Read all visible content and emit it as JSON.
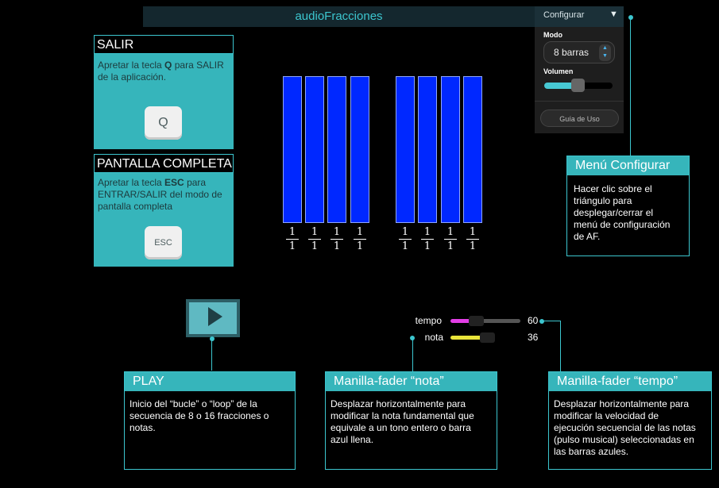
{
  "app": {
    "title": "audioFracciones"
  },
  "config": {
    "title": "Configurar",
    "toggle_glyph": "▼",
    "modo_label": "Modo",
    "modo_value": "8 barras",
    "stepper_glyph": "▲\n▼",
    "volumen_label": "Volumen",
    "volumen_level": 0.44,
    "guia_label": "Guía de Uso"
  },
  "salir": {
    "title": "SALIR",
    "text_a": "Apretar la tecla ",
    "key_bold": "Q",
    "text_b": "  para SALIR de la aplicación.",
    "key_label": "Q"
  },
  "fullscreen": {
    "title": "PANTALLA COMPLETA",
    "text_a": "Apretar la tecla ",
    "key_bold": "ESC",
    "text_b": "  para",
    "text_c": "ENTRAR/SALIR del modo de",
    "text_d": "pantalla completa",
    "key_label": "ESC"
  },
  "bars": {
    "fractions": [
      {
        "num": "1",
        "den": "1"
      },
      {
        "num": "1",
        "den": "1"
      },
      {
        "num": "1",
        "den": "1"
      },
      {
        "num": "1",
        "den": "1"
      },
      {
        "num": "1",
        "den": "1"
      },
      {
        "num": "1",
        "den": "1"
      },
      {
        "num": "1",
        "den": "1"
      },
      {
        "num": "1",
        "den": "1"
      }
    ]
  },
  "faders": {
    "tempo": {
      "label": "tempo",
      "value": "60",
      "color": "#e23ee6"
    },
    "nota": {
      "label": "nota",
      "value": "36",
      "color": "#e8e43a"
    }
  },
  "callouts": {
    "menu": {
      "title": "Menú Configurar",
      "lines": [
        "Hacer clic sobre el",
        "triángulo para",
        "desplegar/cerrar el",
        "menú de configuración",
        "de AF."
      ]
    },
    "play": {
      "title": "PLAY",
      "lines": [
        "Inicio del “bucle” o “loop” de la",
        "secuencia de 8 o 16 fracciones o",
        "notas."
      ]
    },
    "nota": {
      "title": "Manilla-fader “nota”",
      "lines": [
        "Desplazar horizontalmente para",
        "modificar la nota fundamental que",
        "equivale a un tono entero o barra",
        "azul llena."
      ]
    },
    "tempo": {
      "title": "Manilla-fader “tempo”",
      "lines": [
        "Desplazar horizontalmente para",
        "modificar la velocidad de",
        "ejecución secuencial de las notas",
        "(pulso musical) seleccionadas en",
        "las barras azules."
      ]
    }
  },
  "colors": {
    "accent": "#3cc6cf",
    "bar_fill": "#0028ff",
    "panel": "#36b5bb"
  }
}
